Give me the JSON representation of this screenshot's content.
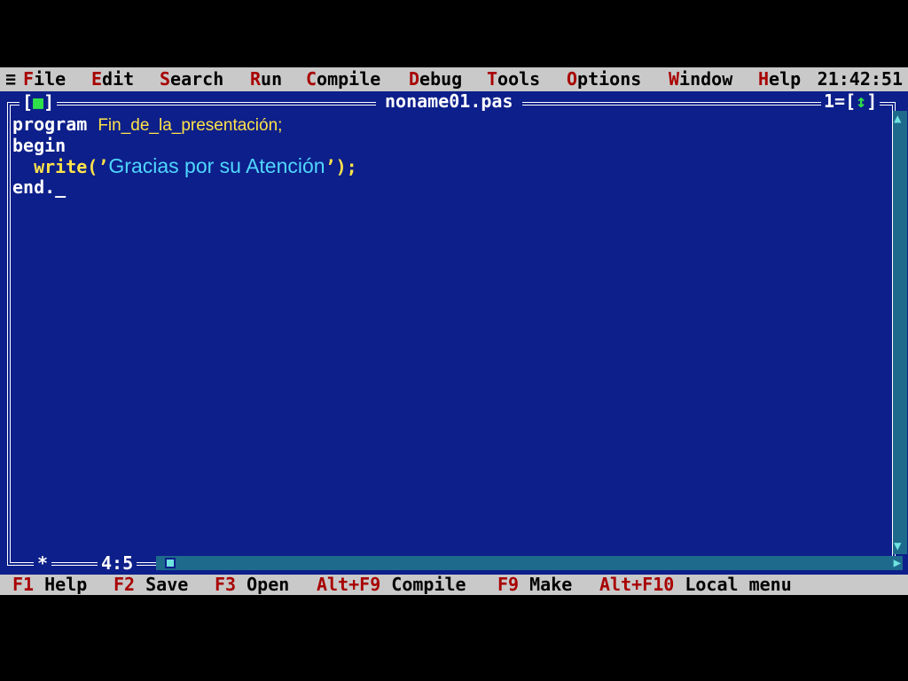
{
  "menu": {
    "system_icon": "≡",
    "items": [
      {
        "hotkey": "F",
        "rest": "ile"
      },
      {
        "hotkey": "E",
        "rest": "dit"
      },
      {
        "hotkey": "S",
        "rest": "earch"
      },
      {
        "hotkey": "R",
        "rest": "un"
      },
      {
        "hotkey": "C",
        "rest": "ompile"
      },
      {
        "hotkey": "D",
        "rest": "ebug"
      },
      {
        "hotkey": "T",
        "rest": "ools"
      },
      {
        "hotkey": "O",
        "rest": "ptions"
      },
      {
        "hotkey": "W",
        "rest": "indow"
      },
      {
        "hotkey": "H",
        "rest": "elp"
      }
    ],
    "clock": "21:42:51"
  },
  "window": {
    "close_left": "[",
    "close_mark": "■",
    "close_right": "]",
    "filename": "noname01.pas",
    "number": "1",
    "zoom_left": "=[",
    "zoom_mark": "↕",
    "zoom_right": "]",
    "modified_mark": "*",
    "cursor_position": "4:5"
  },
  "code": {
    "line1_kw": "program ",
    "line1_ident": "Fin_de_la_presentación;",
    "line2_kw": "begin",
    "line3_indent": "  ",
    "line3_fn": "write(’",
    "line3_str": "Gracias por su Atención",
    "line3_end": "’);",
    "line4_kw": "end.",
    "line4_cursor": "_"
  },
  "hints": [
    {
      "key": "F1",
      "label": "Help"
    },
    {
      "key": "F2",
      "label": "Save"
    },
    {
      "key": "F3",
      "label": "Open"
    },
    {
      "key": "Alt+F9",
      "label": "Compile"
    },
    {
      "key": "F9",
      "label": "Make"
    },
    {
      "key": "Alt+F10",
      "label": "Local menu"
    }
  ],
  "colors": {
    "menu_bg": "#c9c9c9",
    "editor_bg": "#0d1f8a",
    "hotkey": "#a80000",
    "identifier": "#ffe34a",
    "string": "#4fd7ff",
    "accent_green": "#2fe04a",
    "scrollbar": "#1e6a8c"
  }
}
